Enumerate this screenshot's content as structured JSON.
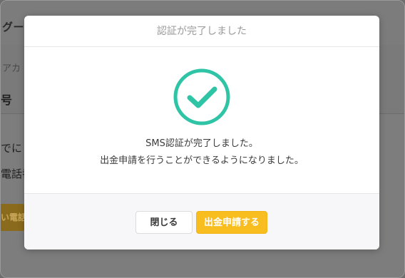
{
  "background": {
    "brand": "グー",
    "breadcrumb": "アカ",
    "heading": "号",
    "text_line1": "でに",
    "text_line2": "電話番",
    "button_label": "い電話"
  },
  "modal": {
    "title": "認証が完了しました",
    "icon": "check-circle-icon",
    "message_line1": "SMS認証が完了しました。",
    "message_line2": "出金申請を行うことができるようになりました。",
    "close_label": "閉じる",
    "withdraw_label": "出金申請する"
  },
  "colors": {
    "accent": "#f8bd1f",
    "success": "#2ec4a5"
  }
}
